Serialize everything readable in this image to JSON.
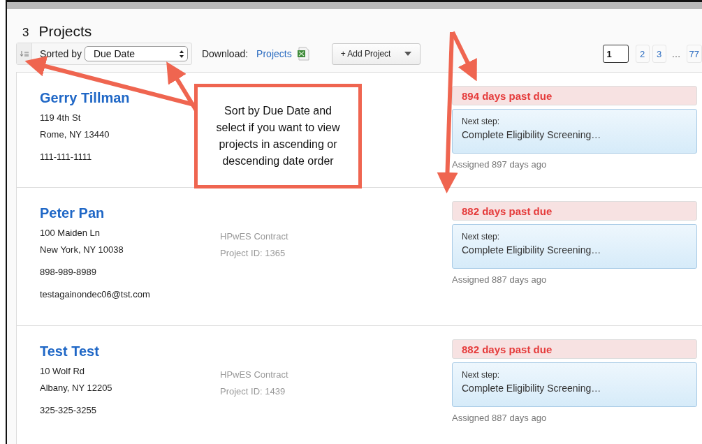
{
  "header": {
    "count": "3",
    "title": "Projects"
  },
  "toolbar": {
    "sort_label": "Sorted by",
    "sort_select": "Due Date",
    "download_label": "Download:",
    "download_link": "Projects",
    "add_button": "+ Add Project"
  },
  "pagination": [
    {
      "kind": "page",
      "label": "1",
      "selected": true
    },
    {
      "kind": "page",
      "label": "2",
      "selected": false
    },
    {
      "kind": "page",
      "label": "3",
      "selected": false
    },
    {
      "kind": "gap",
      "label": "…"
    },
    {
      "kind": "page",
      "label": "77",
      "selected": false
    }
  ],
  "projects": [
    {
      "name": "Gerry Tillman",
      "address": [
        "119 4th St",
        "Rome, NY 13440"
      ],
      "phone": "111-111-1111",
      "due": "894 days past due",
      "next_label": "Next step:",
      "next_step": "Complete Eligibility Screening…",
      "assigned": "Assigned 897 days ago"
    },
    {
      "name": "Peter Pan",
      "address": [
        "100 Maiden Ln",
        "New York, NY 10038"
      ],
      "phone": "898-989-8989",
      "email": "testagainondec06@tst.com",
      "program": "HPwES Contract",
      "project_id": "Project ID: 1365",
      "due": "882 days past due",
      "next_label": "Next step:",
      "next_step": "Complete Eligibility Screening…",
      "assigned": "Assigned 887 days ago"
    },
    {
      "name": "Test Test",
      "address": [
        "10 Wolf Rd",
        "Albany, NY 12205"
      ],
      "phone": "325-325-3255",
      "program": "HPwES Contract",
      "project_id": "Project ID: 1439",
      "due": "882 days past due",
      "next_label": "Next step:",
      "next_step": "Complete Eligibility Screening…",
      "assigned": "Assigned 887 days ago"
    }
  ],
  "callout": {
    "text": "Sort by Due Date and select if you want to view projects in ascending or descending date order"
  }
}
